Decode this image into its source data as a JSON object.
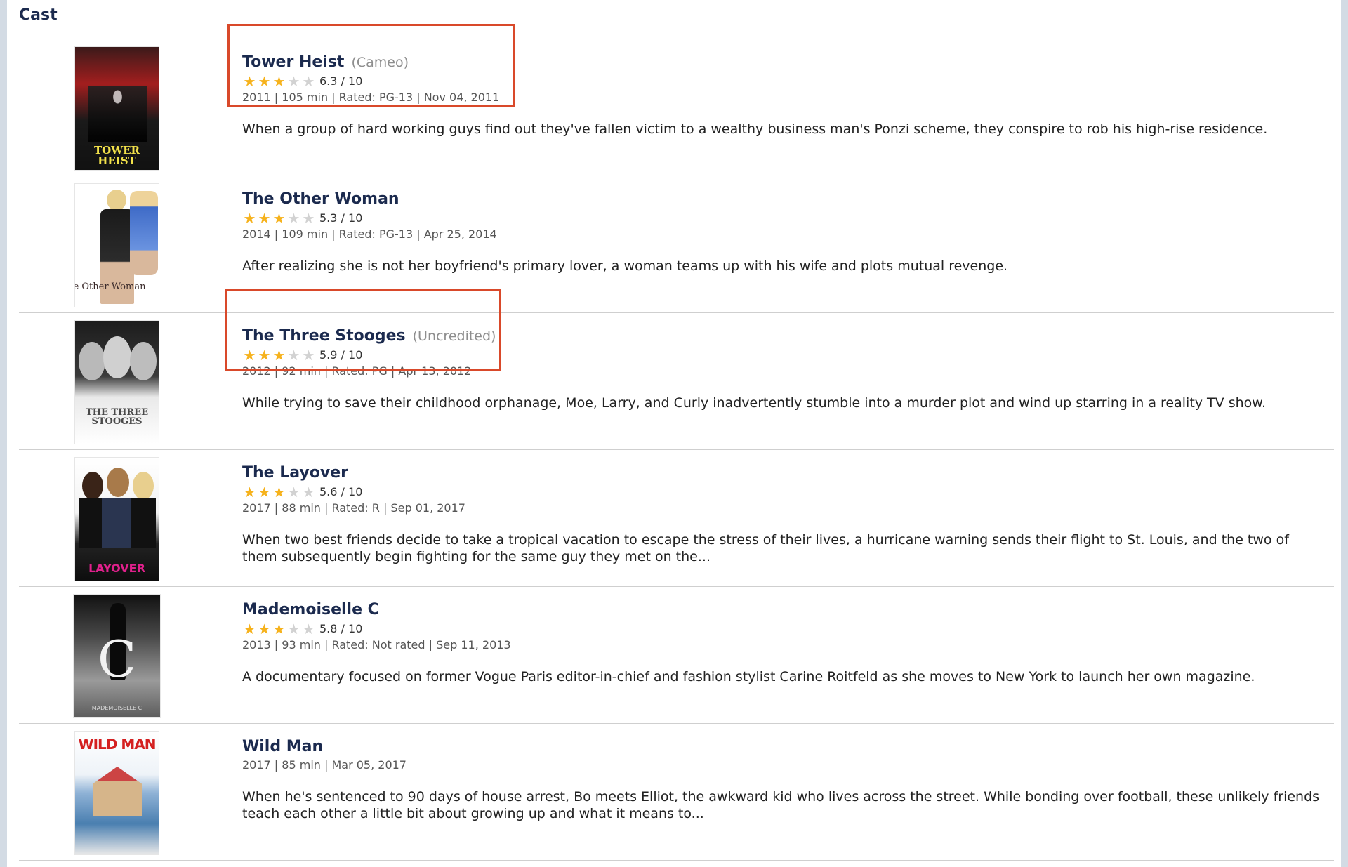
{
  "section": {
    "title": "Cast"
  },
  "movies": [
    {
      "title": "Tower Heist",
      "note": "(Cameo)",
      "stars": 3,
      "rating": "6.3 / 10",
      "meta": "2011 | 105 min | Rated: PG-13 | Nov 04, 2011",
      "description": "When a group of hard working guys find out they've fallen victim to a wealthy business man's Ponzi scheme, they conspire to rob his high-rise residence.",
      "poster_text": "TOWER HEIST",
      "highlighted": true
    },
    {
      "title": "The Other Woman",
      "note": "",
      "stars": 3,
      "rating": "5.3 / 10",
      "meta": "2014 | 109 min | Rated: PG-13 | Apr 25, 2014",
      "description": "After realizing she is not her boyfriend's primary lover, a woman teams up with his wife and plots mutual revenge.",
      "poster_text": "The Other Woman",
      "highlighted": false
    },
    {
      "title": "The Three Stooges",
      "note": "(Uncredited)",
      "stars": 3,
      "rating": "5.9 / 10",
      "meta": "2012 | 92 min | Rated: PG | Apr 13, 2012",
      "description": "While trying to save their childhood orphanage, Moe, Larry, and Curly inadvertently stumble into a murder plot and wind up starring in a reality TV show.",
      "poster_text": "THE THREE STOOGES",
      "highlighted": true
    },
    {
      "title": "The Layover",
      "note": "",
      "stars": 3,
      "rating": "5.6 / 10",
      "meta": "2017 | 88 min | Rated: R | Sep 01, 2017",
      "description": "When two best friends decide to take a tropical vacation to escape the stress of their lives, a hurricane warning sends their flight to St. Louis, and the two of them subsequently begin fighting for the same guy they met on the...",
      "poster_text": "LAYOVER",
      "highlighted": false
    },
    {
      "title": "Mademoiselle C",
      "note": "",
      "stars": 3,
      "rating": "5.8 / 10",
      "meta": "2013 | 93 min | Rated: Not rated | Sep 11, 2013",
      "description": "A documentary focused on former Vogue Paris editor-in-chief and fashion stylist Carine Roitfeld as she moves to New York to launch her own magazine.",
      "poster_text": "MADEMOISELLE C",
      "highlighted": false
    },
    {
      "title": "Wild Man",
      "note": "",
      "stars": null,
      "rating": "",
      "meta": "2017 | 85 min | Mar 05, 2017",
      "description": "When he's sentenced to 90 days of house arrest, Bo meets Elliot, the awkward kid who lives across the street. While bonding over football, these unlikely friends teach each other a little bit about growing up and what it means to...",
      "poster_text": "WILD MAN",
      "highlighted": false
    }
  ],
  "colors": {
    "title": "#1b2a4e",
    "star_on": "#f6b21c",
    "star_off": "#d2d2d2",
    "highlight_box": "#d9492a"
  }
}
